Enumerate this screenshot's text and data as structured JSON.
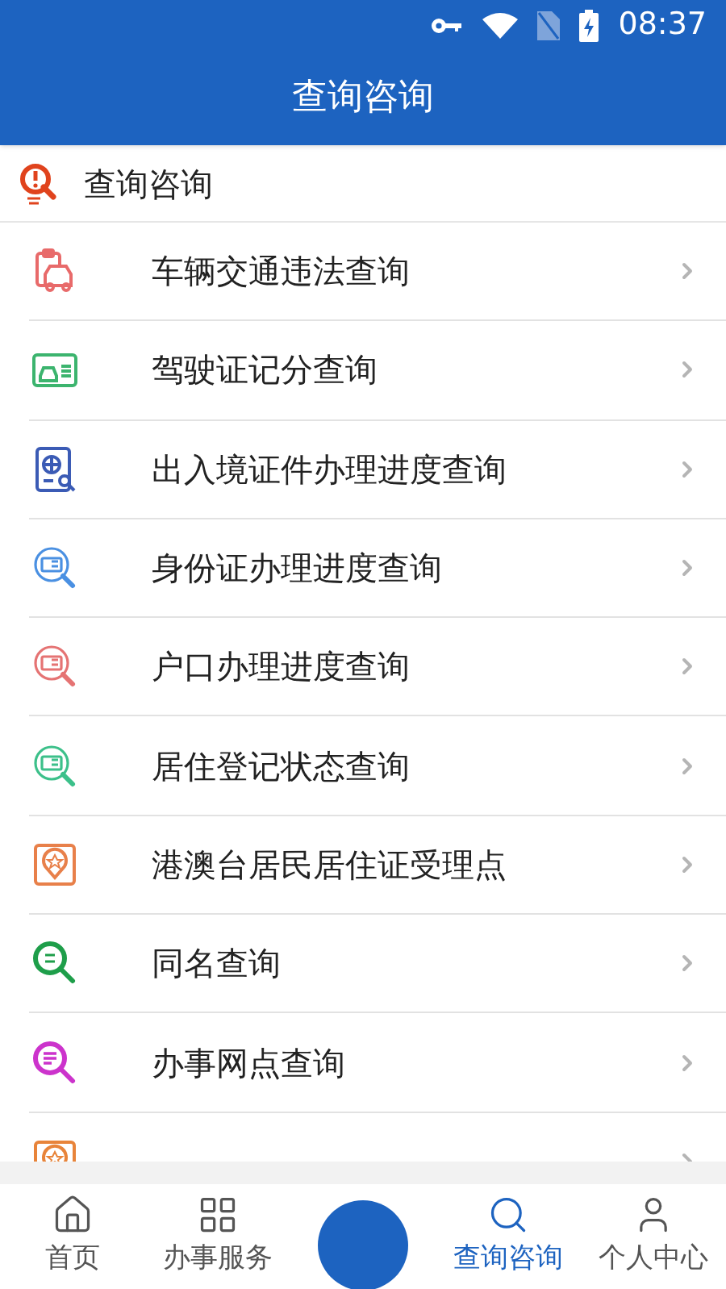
{
  "status_bar": {
    "time": "08:37"
  },
  "app_bar": {
    "title": "查询咨询"
  },
  "section": {
    "title": "查询咨询"
  },
  "items": [
    {
      "label": "车辆交通违法查询",
      "kind": "car",
      "color": "#e86a6a"
    },
    {
      "label": "驾驶证记分查询",
      "kind": "license",
      "color": "#3cb46e"
    },
    {
      "label": "出入境证件办理进度查询",
      "kind": "passport",
      "color": "#3b5bb5"
    },
    {
      "label": "身份证办理进度查询",
      "kind": "search-card",
      "color": "#4a90e2"
    },
    {
      "label": "户口办理进度查询",
      "kind": "search-card",
      "color": "#e57373"
    },
    {
      "label": "居住登记状态查询",
      "kind": "search-card",
      "color": "#3cc08a"
    },
    {
      "label": "港澳台居民居住证受理点",
      "kind": "pin-card",
      "color": "#e8804a"
    },
    {
      "label": "同名查询",
      "kind": "search-name",
      "color": "#1e9e4a"
    },
    {
      "label": "办事网点查询",
      "kind": "search-list",
      "color": "#cc33cc"
    },
    {
      "kind": "pin-card",
      "color": "#e8843a"
    }
  ],
  "bottom_nav": [
    {
      "label": "首页",
      "kind": "home",
      "selected": false
    },
    {
      "label": "办事服务",
      "kind": "grid",
      "selected": false
    },
    {
      "kind": "center",
      "selected": false
    },
    {
      "label": "查询咨询",
      "kind": "search",
      "selected": true
    },
    {
      "label": "个人中心",
      "kind": "user",
      "selected": false
    }
  ]
}
